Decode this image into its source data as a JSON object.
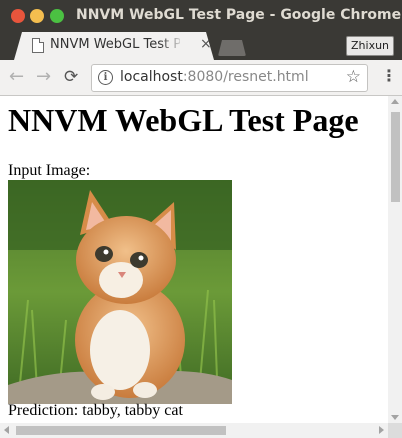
{
  "window": {
    "title": "NNVM WebGL Test Page - Google Chrome"
  },
  "tab": {
    "label": "NNVM WebGL Test Page",
    "close_glyph": "×"
  },
  "profile": {
    "name": "Zhixun"
  },
  "toolbar": {
    "back_glyph": "←",
    "forward_glyph": "→",
    "reload_glyph": "⟳",
    "url_host": "localhost",
    "url_rest": ":8080/resnet.html",
    "star_glyph": "☆",
    "menu_glyph": "⋮",
    "info_glyph": "i"
  },
  "page": {
    "heading": "NNVM WebGL Test Page",
    "input_label": "Input Image:",
    "prediction": "Prediction: tabby, tabby cat"
  },
  "colors": {
    "close": "#e8553c",
    "minimize": "#f4be4f",
    "maximize": "#4bc142",
    "titlebar": "#3a3935"
  },
  "icons": [
    "close-dot-icon",
    "minimize-dot-icon",
    "maximize-dot-icon",
    "page-favicon-icon",
    "back-arrow-icon",
    "forward-arrow-icon",
    "reload-icon",
    "info-icon",
    "bookmark-star-icon",
    "menu-icon"
  ]
}
